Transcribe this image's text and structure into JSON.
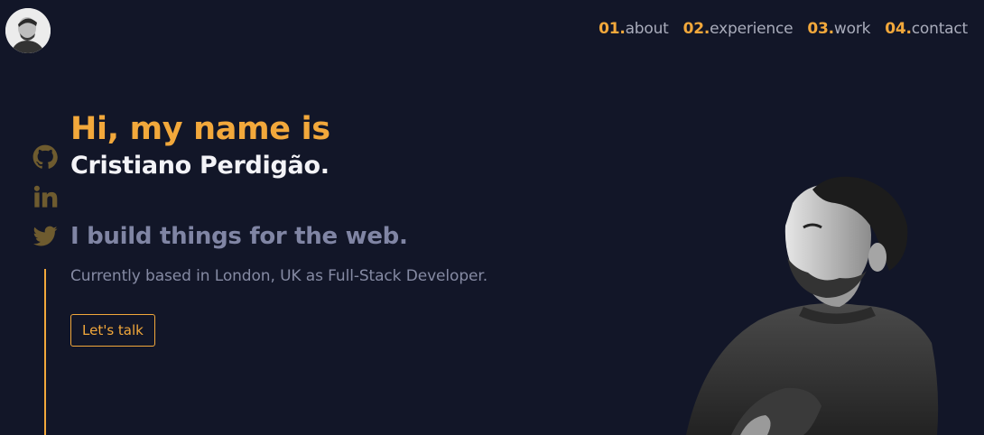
{
  "header": {
    "avatar_icon": "avatar-photo",
    "nav": [
      {
        "num": "01.",
        "label": "about"
      },
      {
        "num": "02.",
        "label": "experience"
      },
      {
        "num": "03.",
        "label": "work"
      },
      {
        "num": "04.",
        "label": "contact"
      }
    ]
  },
  "social": {
    "icons": [
      "github-icon",
      "linkedin-icon",
      "twitter-icon"
    ]
  },
  "hero": {
    "greeting": "Hi, my name is",
    "name": "Cristiano Perdigão.",
    "tagline": "I build things for the web.",
    "subtitle": "Currently based in London, UK as Full-Stack Developer.",
    "cta_label": "Let's talk"
  },
  "colors": {
    "background": "#121628",
    "accent": "#f2a83b",
    "text_primary": "#f3f3f7",
    "text_muted": "#858aa3"
  }
}
